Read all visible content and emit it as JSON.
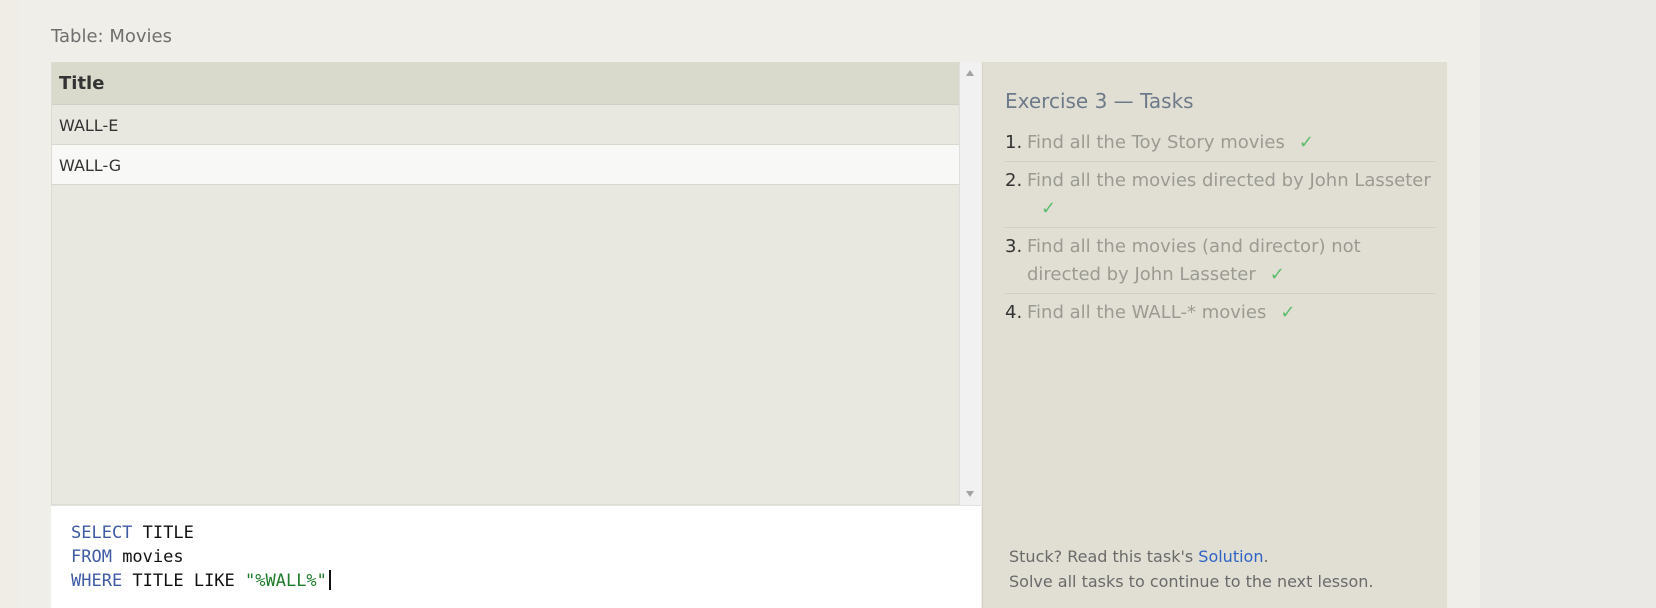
{
  "table_label": "Table: Movies",
  "results": {
    "column": "Title",
    "rows": [
      "WALL-E",
      "WALL-G"
    ]
  },
  "editor": {
    "line1_kw": "SELECT",
    "line1_rest": " TITLE",
    "line2_kw": "FROM",
    "line2_rest": " movies",
    "line3_kw": "WHERE",
    "line3_mid": " TITLE LIKE ",
    "line3_str": "\"%WALL%\""
  },
  "tasks": {
    "title": "Exercise 3 — Tasks",
    "items": [
      {
        "num": "1.",
        "text": "Find all the Toy Story movies",
        "done": "✓"
      },
      {
        "num": "2.",
        "text": "Find all the movies directed by John Lasseter",
        "done": "✓"
      },
      {
        "num": "3.",
        "text": "Find all the movies (and director) not directed by John Lasseter",
        "done": "✓"
      },
      {
        "num": "4.",
        "text": "Find all the WALL-* movies",
        "done": "✓"
      }
    ],
    "help_prefix": "Stuck? Read this task's ",
    "help_link": "Solution",
    "help_suffix": ".",
    "help_line2": "Solve all tasks to continue to the next lesson."
  },
  "colors": {
    "keyword": "#3e5ba4",
    "string": "#1e7b2a",
    "check": "#5bbd6c",
    "link": "#2f64c6"
  }
}
